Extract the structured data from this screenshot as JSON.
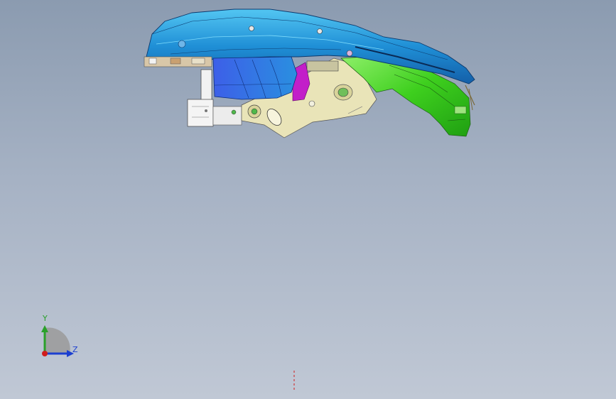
{
  "viewport": {
    "background_top": "#8b9bb0",
    "background_bottom": "#c0c8d5"
  },
  "model": {
    "colors": {
      "housing_blue": "#1f8fd6",
      "inner_blue": "#2f6fe0",
      "bracket_cream": "#e9e4b8",
      "bracket_green": "#3ecf1e",
      "accent_magenta": "#c21fc9",
      "bracket_white": "#f2f2f2"
    }
  },
  "triad": {
    "y_label": "Y",
    "z_label": "Z",
    "y_color": "#2aa02a",
    "z_color": "#1c3fd0",
    "x_color": "#d01c1c"
  }
}
